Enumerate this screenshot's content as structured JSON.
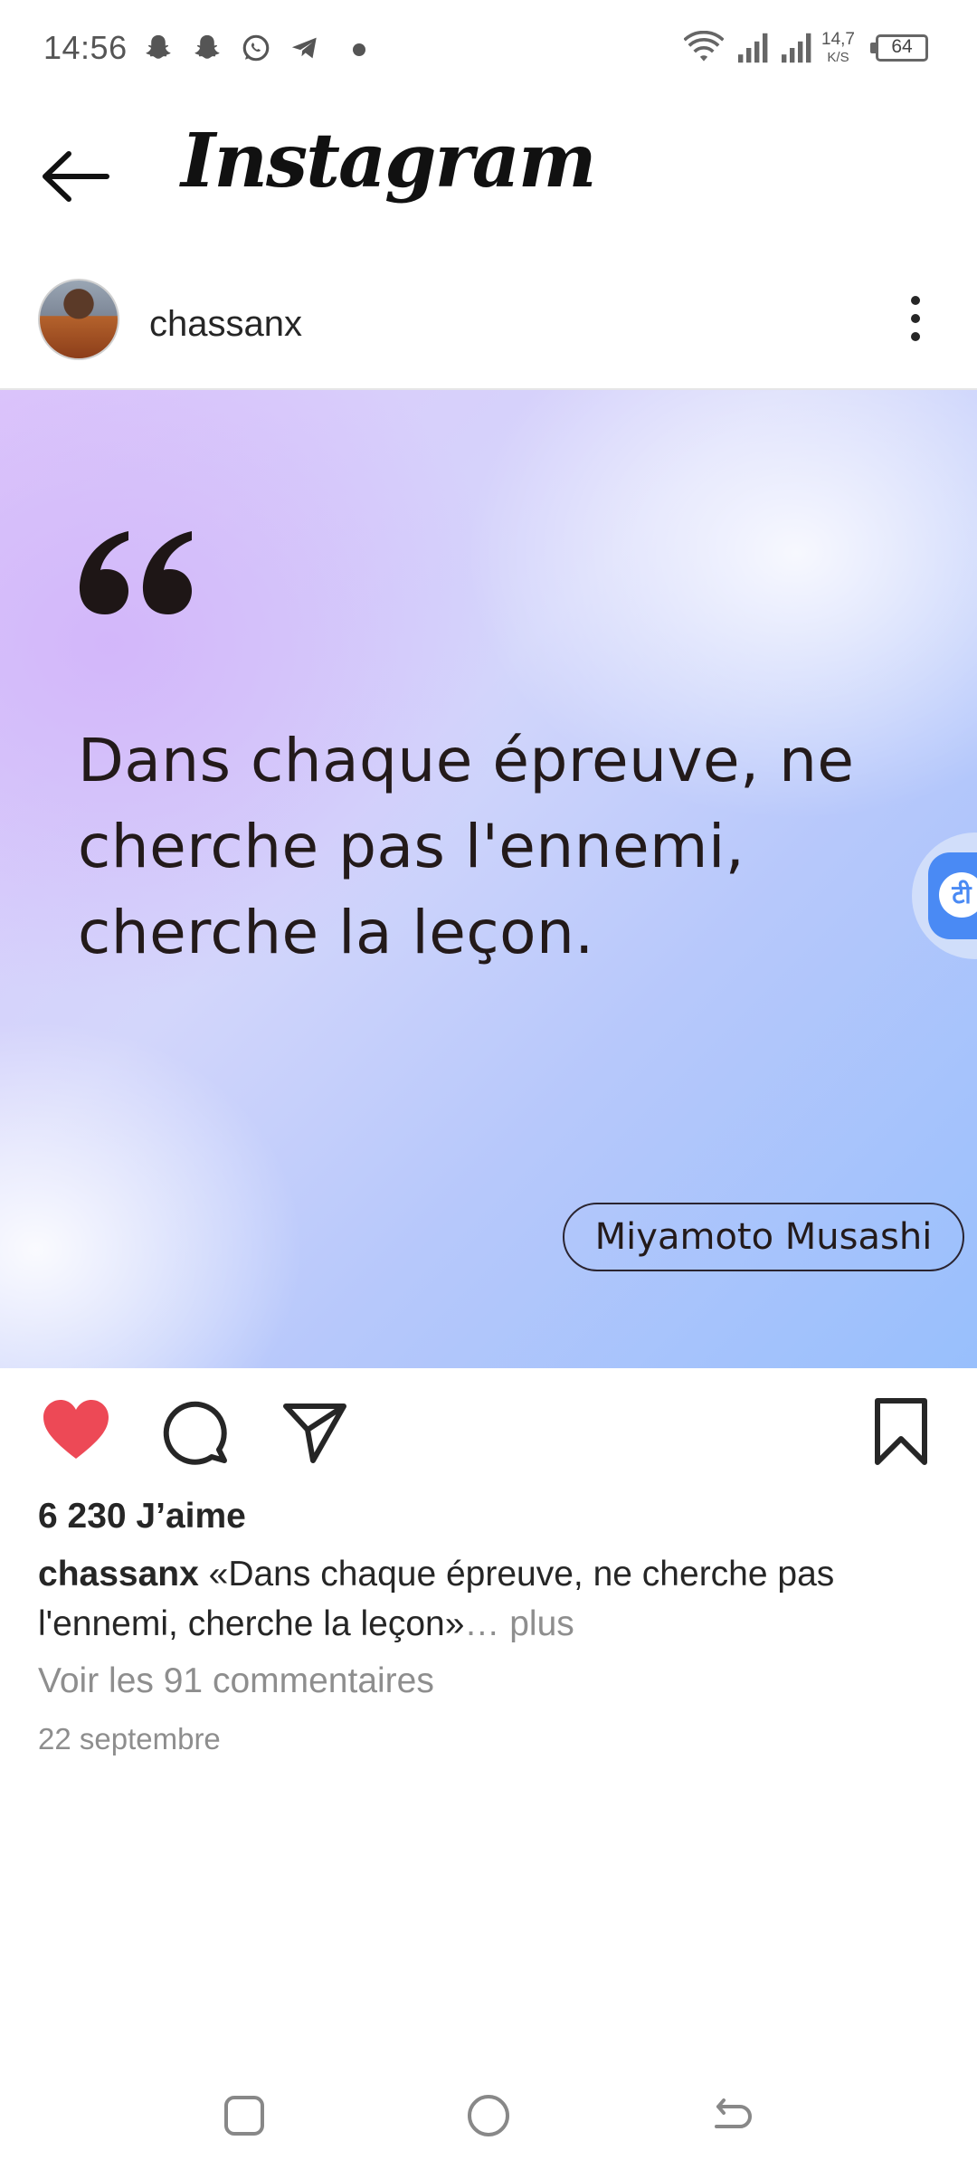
{
  "status_bar": {
    "time": "14:56",
    "network_speed_value": "14,7",
    "network_speed_unit": "K/S",
    "battery": "64"
  },
  "header": {
    "app_title": "Instagram"
  },
  "post": {
    "username": "chassanx",
    "quote_text": "Dans chaque épreuve, ne cherche pas l'ennemi, cherche la leçon.",
    "author": "Miyamoto Musashi",
    "likes": "6 230 J’aime",
    "caption_username": "chassanx",
    "caption_text": " «Dans chaque épreuve, ne cherche pas l'ennemi, cherche la leçon»",
    "caption_more": "… plus",
    "comments_link": "Voir les 91 commentaires",
    "date": "22 septembre"
  },
  "floating": {
    "translate_glyph": "टी"
  },
  "colors": {
    "like_red": "#ed4956",
    "text_primary": "#262626",
    "text_secondary": "#8e8e8e",
    "translate_blue": "#4a8af4"
  }
}
